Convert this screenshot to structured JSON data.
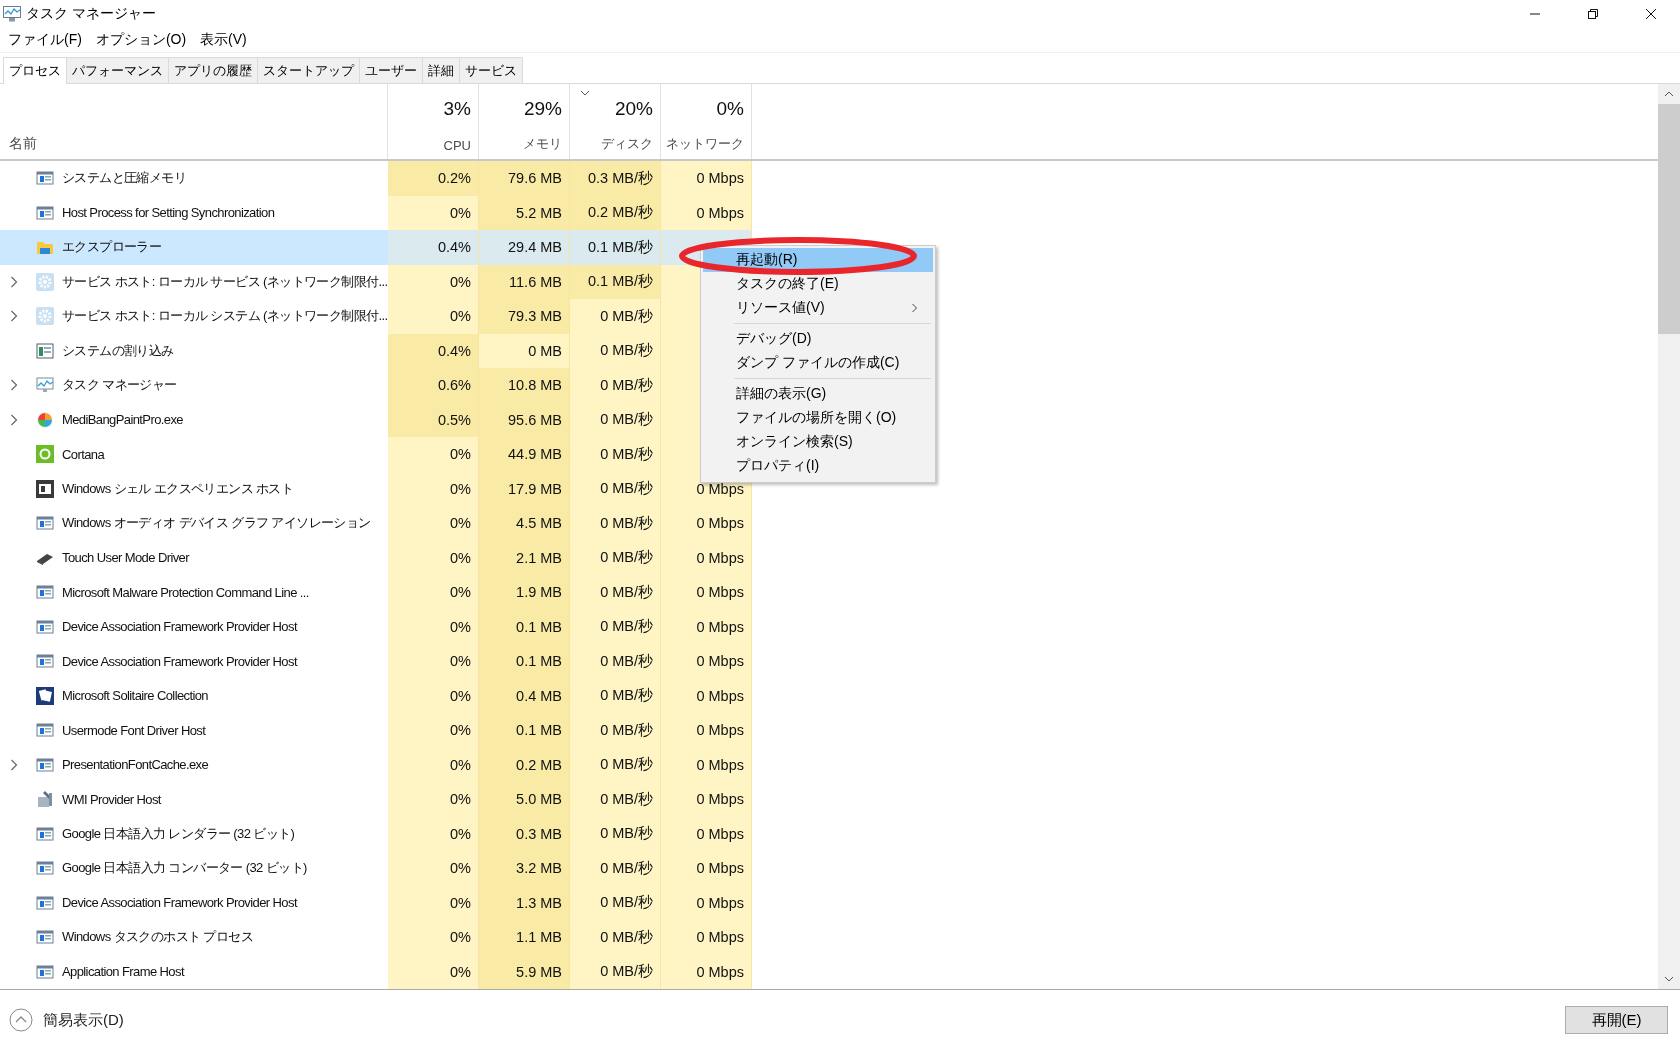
{
  "window": {
    "title": "タスク マネージャー"
  },
  "menu_bar": [
    "ファイル(F)",
    "オプション(O)",
    "表示(V)"
  ],
  "tabs": [
    {
      "label": "プロセス",
      "selected": true
    },
    {
      "label": "パフォーマンス",
      "selected": false
    },
    {
      "label": "アプリの履歴",
      "selected": false
    },
    {
      "label": "スタートアップ",
      "selected": false
    },
    {
      "label": "ユーザー",
      "selected": false
    },
    {
      "label": "詳細",
      "selected": false
    },
    {
      "label": "サービス",
      "selected": false
    }
  ],
  "table": {
    "name_header": "名前",
    "columns": [
      {
        "percent": "3%",
        "label": "CPU",
        "sorted": false
      },
      {
        "percent": "29%",
        "label": "メモリ",
        "sorted": false
      },
      {
        "percent": "20%",
        "label": "ディスク",
        "sorted": true
      },
      {
        "percent": "0%",
        "label": "ネットワーク",
        "sorted": false
      }
    ],
    "rows": [
      {
        "name": "システムと圧縮メモリ",
        "kind": "window",
        "expandable": false,
        "selected": false,
        "cells": [
          {
            "v": "0.2%",
            "hot": true
          },
          {
            "v": "79.6 MB",
            "hot": true
          },
          {
            "v": "0.3 MB/秒",
            "hot": true
          },
          {
            "v": "0 Mbps",
            "hot": false
          }
        ]
      },
      {
        "name": "Host Process for Setting Synchronization",
        "kind": "window",
        "expandable": false,
        "selected": false,
        "cells": [
          {
            "v": "0%",
            "hot": false
          },
          {
            "v": "5.2 MB",
            "hot": true
          },
          {
            "v": "0.2 MB/秒",
            "hot": true
          },
          {
            "v": "0 Mbps",
            "hot": false
          }
        ]
      },
      {
        "name": "エクスプローラー",
        "kind": "folder",
        "expandable": false,
        "selected": true,
        "cells": [
          {
            "v": "0.4%",
            "hot": false
          },
          {
            "v": "29.4 MB",
            "hot": false
          },
          {
            "v": "0.1 MB/秒",
            "hot": false
          }
        ]
      },
      {
        "name": "サービス ホスト: ローカル サービス (ネットワーク制限付...",
        "kind": "gear",
        "expandable": true,
        "selected": false,
        "cells": [
          {
            "v": "0%",
            "hot": false
          },
          {
            "v": "11.6 MB",
            "hot": true
          },
          {
            "v": "0.1 MB/秒",
            "hot": true
          }
        ]
      },
      {
        "name": "サービス ホスト: ローカル システム (ネットワーク制限付...",
        "kind": "gear",
        "expandable": true,
        "selected": false,
        "cells": [
          {
            "v": "0%",
            "hot": false
          },
          {
            "v": "79.3 MB",
            "hot": true
          },
          {
            "v": "0 MB/秒",
            "hot": false
          }
        ]
      },
      {
        "name": "システムの割り込み",
        "kind": "monitor",
        "expandable": false,
        "selected": false,
        "cells": [
          {
            "v": "0.4%",
            "hot": true
          },
          {
            "v": "0 MB",
            "hot": false
          },
          {
            "v": "0 MB/秒",
            "hot": false
          }
        ]
      },
      {
        "name": "タスク マネージャー",
        "kind": "chart",
        "expandable": true,
        "selected": false,
        "cells": [
          {
            "v": "0.6%",
            "hot": true
          },
          {
            "v": "10.8 MB",
            "hot": true
          },
          {
            "v": "0 MB/秒",
            "hot": false
          }
        ]
      },
      {
        "name": "MediBangPaintPro.exe",
        "kind": "ball",
        "expandable": true,
        "selected": false,
        "cells": [
          {
            "v": "0.5%",
            "hot": true
          },
          {
            "v": "95.6 MB",
            "hot": true
          },
          {
            "v": "0 MB/秒",
            "hot": false
          }
        ]
      },
      {
        "name": "Cortana",
        "kind": "ring",
        "expandable": false,
        "selected": false,
        "cells": [
          {
            "v": "0%",
            "hot": false
          },
          {
            "v": "44.9 MB",
            "hot": true
          },
          {
            "v": "0 MB/秒",
            "hot": false
          }
        ]
      },
      {
        "name": "Windows シェル エクスペリエンス ホスト",
        "kind": "dark",
        "expandable": false,
        "selected": false,
        "cells": [
          {
            "v": "0%",
            "hot": false
          },
          {
            "v": "17.9 MB",
            "hot": true
          },
          {
            "v": "0 MB/秒",
            "hot": false
          },
          {
            "v": "0 Mbps",
            "hot": false
          }
        ]
      },
      {
        "name": "Windows オーディオ デバイス グラフ アイソレーション",
        "kind": "window",
        "expandable": false,
        "selected": false,
        "cells": [
          {
            "v": "0%",
            "hot": false
          },
          {
            "v": "4.5 MB",
            "hot": true
          },
          {
            "v": "0 MB/秒",
            "hot": false
          },
          {
            "v": "0 Mbps",
            "hot": false
          }
        ]
      },
      {
        "name": "Touch User Mode Driver",
        "kind": "pen",
        "expandable": false,
        "selected": false,
        "cells": [
          {
            "v": "0%",
            "hot": false
          },
          {
            "v": "2.1 MB",
            "hot": true
          },
          {
            "v": "0 MB/秒",
            "hot": false
          },
          {
            "v": "0 Mbps",
            "hot": false
          }
        ]
      },
      {
        "name": "Microsoft Malware Protection Command Line ...",
        "kind": "window",
        "expandable": false,
        "selected": false,
        "cells": [
          {
            "v": "0%",
            "hot": false
          },
          {
            "v": "1.9 MB",
            "hot": true
          },
          {
            "v": "0 MB/秒",
            "hot": false
          },
          {
            "v": "0 Mbps",
            "hot": false
          }
        ]
      },
      {
        "name": "Device Association Framework Provider Host",
        "kind": "window",
        "expandable": false,
        "selected": false,
        "cells": [
          {
            "v": "0%",
            "hot": false
          },
          {
            "v": "0.1 MB",
            "hot": true
          },
          {
            "v": "0 MB/秒",
            "hot": false
          },
          {
            "v": "0 Mbps",
            "hot": false
          }
        ]
      },
      {
        "name": "Device Association Framework Provider Host",
        "kind": "window",
        "expandable": false,
        "selected": false,
        "cells": [
          {
            "v": "0%",
            "hot": false
          },
          {
            "v": "0.1 MB",
            "hot": true
          },
          {
            "v": "0 MB/秒",
            "hot": false
          },
          {
            "v": "0 Mbps",
            "hot": false
          }
        ]
      },
      {
        "name": "Microsoft Solitaire Collection",
        "kind": "cards",
        "expandable": false,
        "selected": false,
        "cells": [
          {
            "v": "0%",
            "hot": false
          },
          {
            "v": "0.4 MB",
            "hot": true
          },
          {
            "v": "0 MB/秒",
            "hot": false
          },
          {
            "v": "0 Mbps",
            "hot": false
          }
        ]
      },
      {
        "name": "Usermode Font Driver Host",
        "kind": "window",
        "expandable": false,
        "selected": false,
        "cells": [
          {
            "v": "0%",
            "hot": false
          },
          {
            "v": "0.1 MB",
            "hot": true
          },
          {
            "v": "0 MB/秒",
            "hot": false
          },
          {
            "v": "0 Mbps",
            "hot": false
          }
        ]
      },
      {
        "name": "PresentationFontCache.exe",
        "kind": "window",
        "expandable": true,
        "selected": false,
        "cells": [
          {
            "v": "0%",
            "hot": false
          },
          {
            "v": "0.2 MB",
            "hot": true
          },
          {
            "v": "0 MB/秒",
            "hot": false
          },
          {
            "v": "0 Mbps",
            "hot": false
          }
        ]
      },
      {
        "name": "WMI Provider Host",
        "kind": "tools",
        "expandable": false,
        "selected": false,
        "cells": [
          {
            "v": "0%",
            "hot": false
          },
          {
            "v": "5.0 MB",
            "hot": true
          },
          {
            "v": "0 MB/秒",
            "hot": false
          },
          {
            "v": "0 Mbps",
            "hot": false
          }
        ]
      },
      {
        "name": "Google 日本語入力 レンダラー (32 ビット)",
        "kind": "window",
        "expandable": false,
        "selected": false,
        "cells": [
          {
            "v": "0%",
            "hot": false
          },
          {
            "v": "0.3 MB",
            "hot": true
          },
          {
            "v": "0 MB/秒",
            "hot": false
          },
          {
            "v": "0 Mbps",
            "hot": false
          }
        ]
      },
      {
        "name": "Google 日本語入力 コンバーター (32 ビット)",
        "kind": "window",
        "expandable": false,
        "selected": false,
        "cells": [
          {
            "v": "0%",
            "hot": false
          },
          {
            "v": "3.2 MB",
            "hot": true
          },
          {
            "v": "0 MB/秒",
            "hot": false
          },
          {
            "v": "0 Mbps",
            "hot": false
          }
        ]
      },
      {
        "name": "Device Association Framework Provider Host",
        "kind": "window",
        "expandable": false,
        "selected": false,
        "cells": [
          {
            "v": "0%",
            "hot": false
          },
          {
            "v": "1.3 MB",
            "hot": true
          },
          {
            "v": "0 MB/秒",
            "hot": false
          },
          {
            "v": "0 Mbps",
            "hot": false
          }
        ]
      },
      {
        "name": "Windows タスクのホスト プロセス",
        "kind": "window",
        "expandable": false,
        "selected": false,
        "cells": [
          {
            "v": "0%",
            "hot": false
          },
          {
            "v": "1.1 MB",
            "hot": true
          },
          {
            "v": "0 MB/秒",
            "hot": false
          },
          {
            "v": "0 Mbps",
            "hot": false
          }
        ]
      },
      {
        "name": "Application Frame Host",
        "kind": "window",
        "expandable": false,
        "selected": false,
        "cells": [
          {
            "v": "0%",
            "hot": false
          },
          {
            "v": "5.9 MB",
            "hot": true
          },
          {
            "v": "0 MB/秒",
            "hot": false
          },
          {
            "v": "0 Mbps",
            "hot": false
          }
        ]
      }
    ]
  },
  "context_menu": [
    {
      "kind": "item",
      "label": "再起動(R)",
      "selected": true
    },
    {
      "kind": "item",
      "label": "タスクの終了(E)",
      "selected": false
    },
    {
      "kind": "submenu",
      "label": "リソース値(V)",
      "selected": false
    },
    {
      "kind": "separator"
    },
    {
      "kind": "item",
      "label": "デバッグ(D)",
      "selected": false
    },
    {
      "kind": "item",
      "label": "ダンプ ファイルの作成(C)",
      "selected": false
    },
    {
      "kind": "separator"
    },
    {
      "kind": "item",
      "label": "詳細の表示(G)",
      "selected": false
    },
    {
      "kind": "item",
      "label": "ファイルの場所を開く(O)",
      "selected": false
    },
    {
      "kind": "item",
      "label": "オンライン検索(S)",
      "selected": false
    },
    {
      "kind": "item",
      "label": "プロパティ(I)",
      "selected": false
    }
  ],
  "footer": {
    "fewer_details": "簡易表示(D)",
    "button": "再開(E)"
  }
}
